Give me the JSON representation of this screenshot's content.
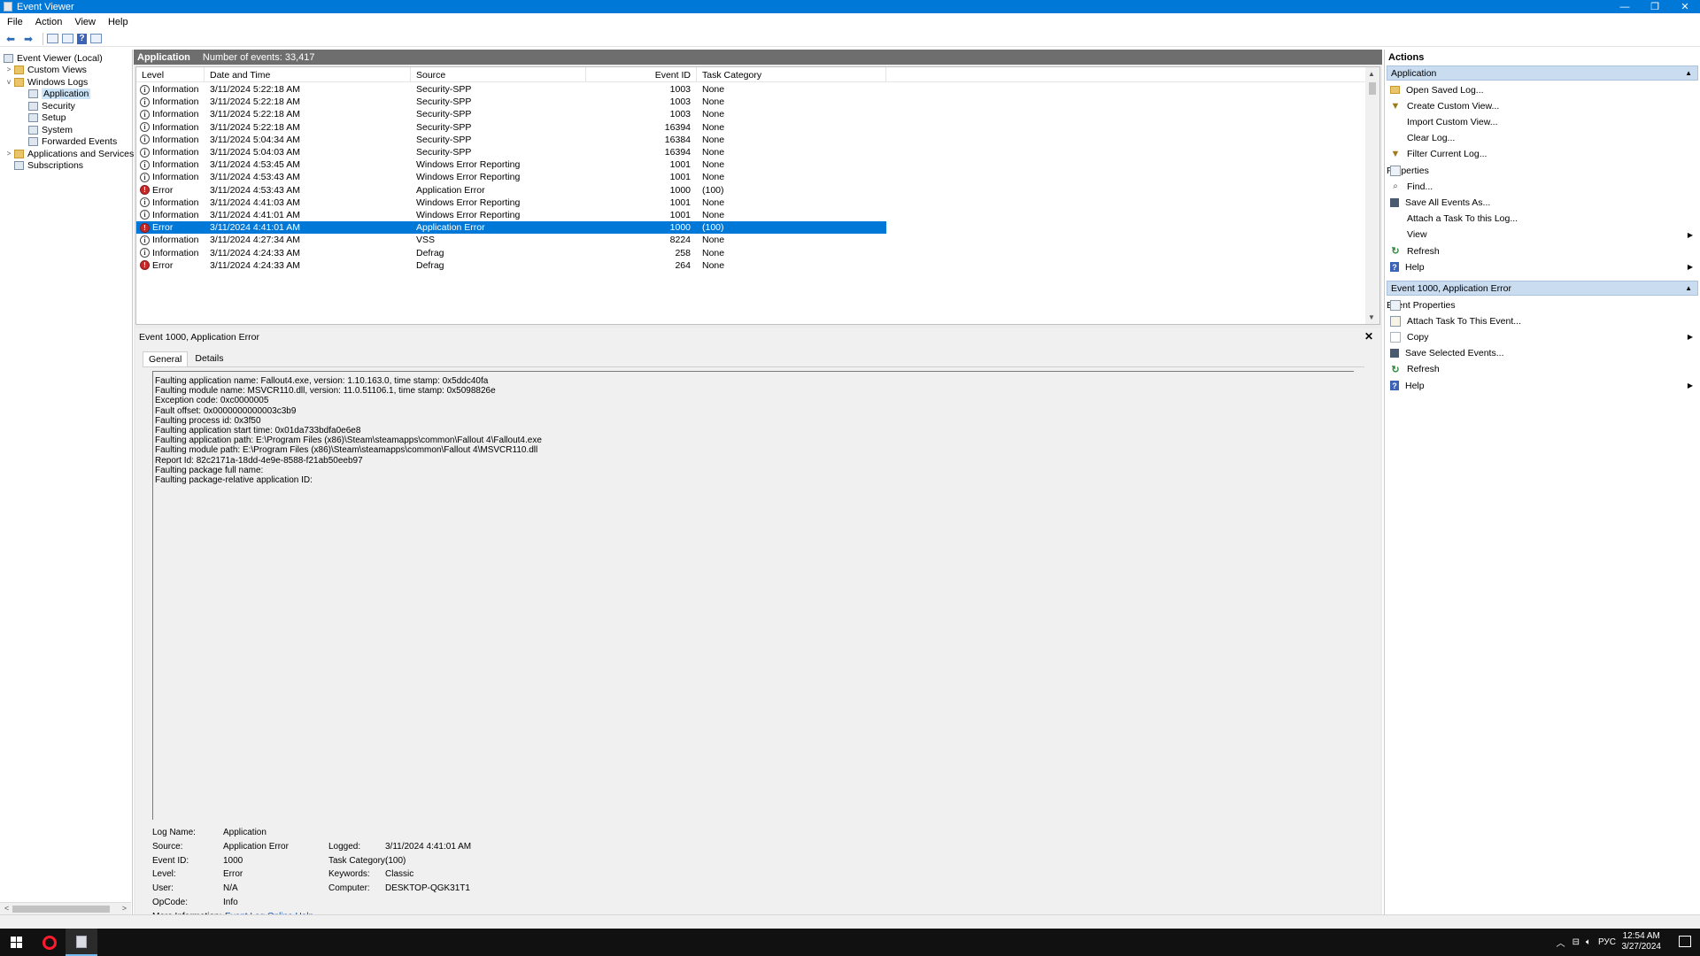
{
  "window": {
    "title": "Event Viewer",
    "controls": [
      "—",
      "❐",
      "✕"
    ]
  },
  "menubar": [
    "File",
    "Action",
    "View",
    "Help"
  ],
  "tree": {
    "items": [
      {
        "label": "Event Viewer (Local)",
        "level": 0,
        "expander": "",
        "icon": "computer-icon"
      },
      {
        "label": "Custom Views",
        "level": 1,
        "expander": ">",
        "icon": "folder-icon"
      },
      {
        "label": "Windows Logs",
        "level": 1,
        "expander": "v",
        "icon": "folder-icon"
      },
      {
        "label": "Application",
        "level": 2,
        "expander": "",
        "icon": "log-icon",
        "selected": true
      },
      {
        "label": "Security",
        "level": 2,
        "expander": "",
        "icon": "log-icon"
      },
      {
        "label": "Setup",
        "level": 2,
        "expander": "",
        "icon": "log-icon"
      },
      {
        "label": "System",
        "level": 2,
        "expander": "",
        "icon": "log-icon"
      },
      {
        "label": "Forwarded Events",
        "level": 2,
        "expander": "",
        "icon": "log-icon"
      },
      {
        "label": "Applications and Services Lo",
        "level": 1,
        "expander": ">",
        "icon": "folder-icon"
      },
      {
        "label": "Subscriptions",
        "level": 1,
        "expander": "",
        "icon": "log-icon"
      }
    ]
  },
  "list": {
    "header_name": "Application",
    "header_count": "Number of events: 33,417",
    "columns": [
      "Level",
      "Date and Time",
      "Source",
      "Event ID",
      "Task Category"
    ],
    "rows": [
      {
        "level": "Information",
        "date": "3/11/2024 5:22:18 AM",
        "source": "Security-SPP",
        "id": "1003",
        "category": "None"
      },
      {
        "level": "Information",
        "date": "3/11/2024 5:22:18 AM",
        "source": "Security-SPP",
        "id": "1003",
        "category": "None"
      },
      {
        "level": "Information",
        "date": "3/11/2024 5:22:18 AM",
        "source": "Security-SPP",
        "id": "1003",
        "category": "None"
      },
      {
        "level": "Information",
        "date": "3/11/2024 5:22:18 AM",
        "source": "Security-SPP",
        "id": "16394",
        "category": "None"
      },
      {
        "level": "Information",
        "date": "3/11/2024 5:04:34 AM",
        "source": "Security-SPP",
        "id": "16384",
        "category": "None"
      },
      {
        "level": "Information",
        "date": "3/11/2024 5:04:03 AM",
        "source": "Security-SPP",
        "id": "16394",
        "category": "None"
      },
      {
        "level": "Information",
        "date": "3/11/2024 4:53:45 AM",
        "source": "Windows Error Reporting",
        "id": "1001",
        "category": "None"
      },
      {
        "level": "Information",
        "date": "3/11/2024 4:53:43 AM",
        "source": "Windows Error Reporting",
        "id": "1001",
        "category": "None"
      },
      {
        "level": "Error",
        "date": "3/11/2024 4:53:43 AM",
        "source": "Application Error",
        "id": "1000",
        "category": "(100)"
      },
      {
        "level": "Information",
        "date": "3/11/2024 4:41:03 AM",
        "source": "Windows Error Reporting",
        "id": "1001",
        "category": "None"
      },
      {
        "level": "Information",
        "date": "3/11/2024 4:41:01 AM",
        "source": "Windows Error Reporting",
        "id": "1001",
        "category": "None"
      },
      {
        "level": "Error",
        "date": "3/11/2024 4:41:01 AM",
        "source": "Application Error",
        "id": "1000",
        "category": "(100)",
        "selected": true
      },
      {
        "level": "Information",
        "date": "3/11/2024 4:27:34 AM",
        "source": "VSS",
        "id": "8224",
        "category": "None"
      },
      {
        "level": "Information",
        "date": "3/11/2024 4:24:33 AM",
        "source": "Defrag",
        "id": "258",
        "category": "None"
      },
      {
        "level": "Error",
        "date": "3/11/2024 4:24:33 AM",
        "source": "Defrag",
        "id": "264",
        "category": "None"
      }
    ]
  },
  "detail": {
    "title": "Event 1000, Application Error",
    "close": "✕",
    "tabs": [
      "General",
      "Details"
    ],
    "description_lines": [
      "Faulting application name: Fallout4.exe, version: 1.10.163.0, time stamp: 0x5ddc40fa",
      "Faulting module name: MSVCR110.dll, version: 11.0.51106.1, time stamp: 0x5098826e",
      "Exception code: 0xc0000005",
      "Fault offset: 0x0000000000003c3b9",
      "Faulting process id: 0x3f50",
      "Faulting application start time: 0x01da733bdfa0e6e8",
      "Faulting application path: E:\\Program Files (x86)\\Steam\\steamapps\\common\\Fallout 4\\Fallout4.exe",
      "Faulting module path: E:\\Program Files (x86)\\Steam\\steamapps\\common\\Fallout 4\\MSVCR110.dll",
      "Report Id: 82c2171a-18dd-4e9e-8588-f21ab50eeb97",
      "Faulting package full name:",
      "Faulting package-relative application ID:"
    ],
    "props": {
      "log_name_label": "Log Name:",
      "log_name": "Application",
      "source_label": "Source:",
      "source": "Application Error",
      "logged_label": "Logged:",
      "logged": "3/11/2024 4:41:01 AM",
      "event_id_label": "Event ID:",
      "event_id": "1000",
      "task_category_label": "Task Category:",
      "task_category": "(100)",
      "level_label": "Level:",
      "level": "Error",
      "keywords_label": "Keywords:",
      "keywords": "Classic",
      "user_label": "User:",
      "user": "N/A",
      "computer_label": "Computer:",
      "computer": "DESKTOP-QGK31T1",
      "opcode_label": "OpCode:",
      "opcode": "Info",
      "more_info_label": "More Information:",
      "more_info_link": "Event Log Online Help"
    }
  },
  "actions": {
    "title": "Actions",
    "section1": {
      "title": "Application",
      "items": [
        {
          "label": "Open Saved Log...",
          "icon": "folder-icon"
        },
        {
          "label": "Create Custom View...",
          "icon": "filter-icon"
        },
        {
          "label": "Import Custom View...",
          "icon": "blank"
        },
        {
          "label": "Clear Log...",
          "icon": "blank"
        },
        {
          "label": "Filter Current Log...",
          "icon": "filter-icon"
        },
        {
          "label": "Properties",
          "icon": "properties-icon"
        },
        {
          "label": "Find...",
          "icon": "find-icon"
        },
        {
          "label": "Save All Events As...",
          "icon": "save-icon"
        },
        {
          "label": "Attach a Task To this Log...",
          "icon": "blank"
        },
        {
          "label": "View",
          "icon": "blank",
          "submenu": true
        },
        {
          "label": "Refresh",
          "icon": "refresh-icon"
        },
        {
          "label": "Help",
          "icon": "help-icon",
          "submenu": true
        }
      ]
    },
    "section2": {
      "title": "Event 1000, Application Error",
      "items": [
        {
          "label": "Event Properties",
          "icon": "properties-icon"
        },
        {
          "label": "Attach Task To This Event...",
          "icon": "task-icon"
        },
        {
          "label": "Copy",
          "icon": "copy-icon",
          "submenu": true
        },
        {
          "label": "Save Selected Events...",
          "icon": "save-icon"
        },
        {
          "label": "Refresh",
          "icon": "refresh-icon"
        },
        {
          "label": "Help",
          "icon": "help-icon",
          "submenu": true
        }
      ]
    }
  },
  "taskbar": {
    "tray_lang": "РУС",
    "time": "12:54 AM",
    "date": "3/27/2024"
  }
}
